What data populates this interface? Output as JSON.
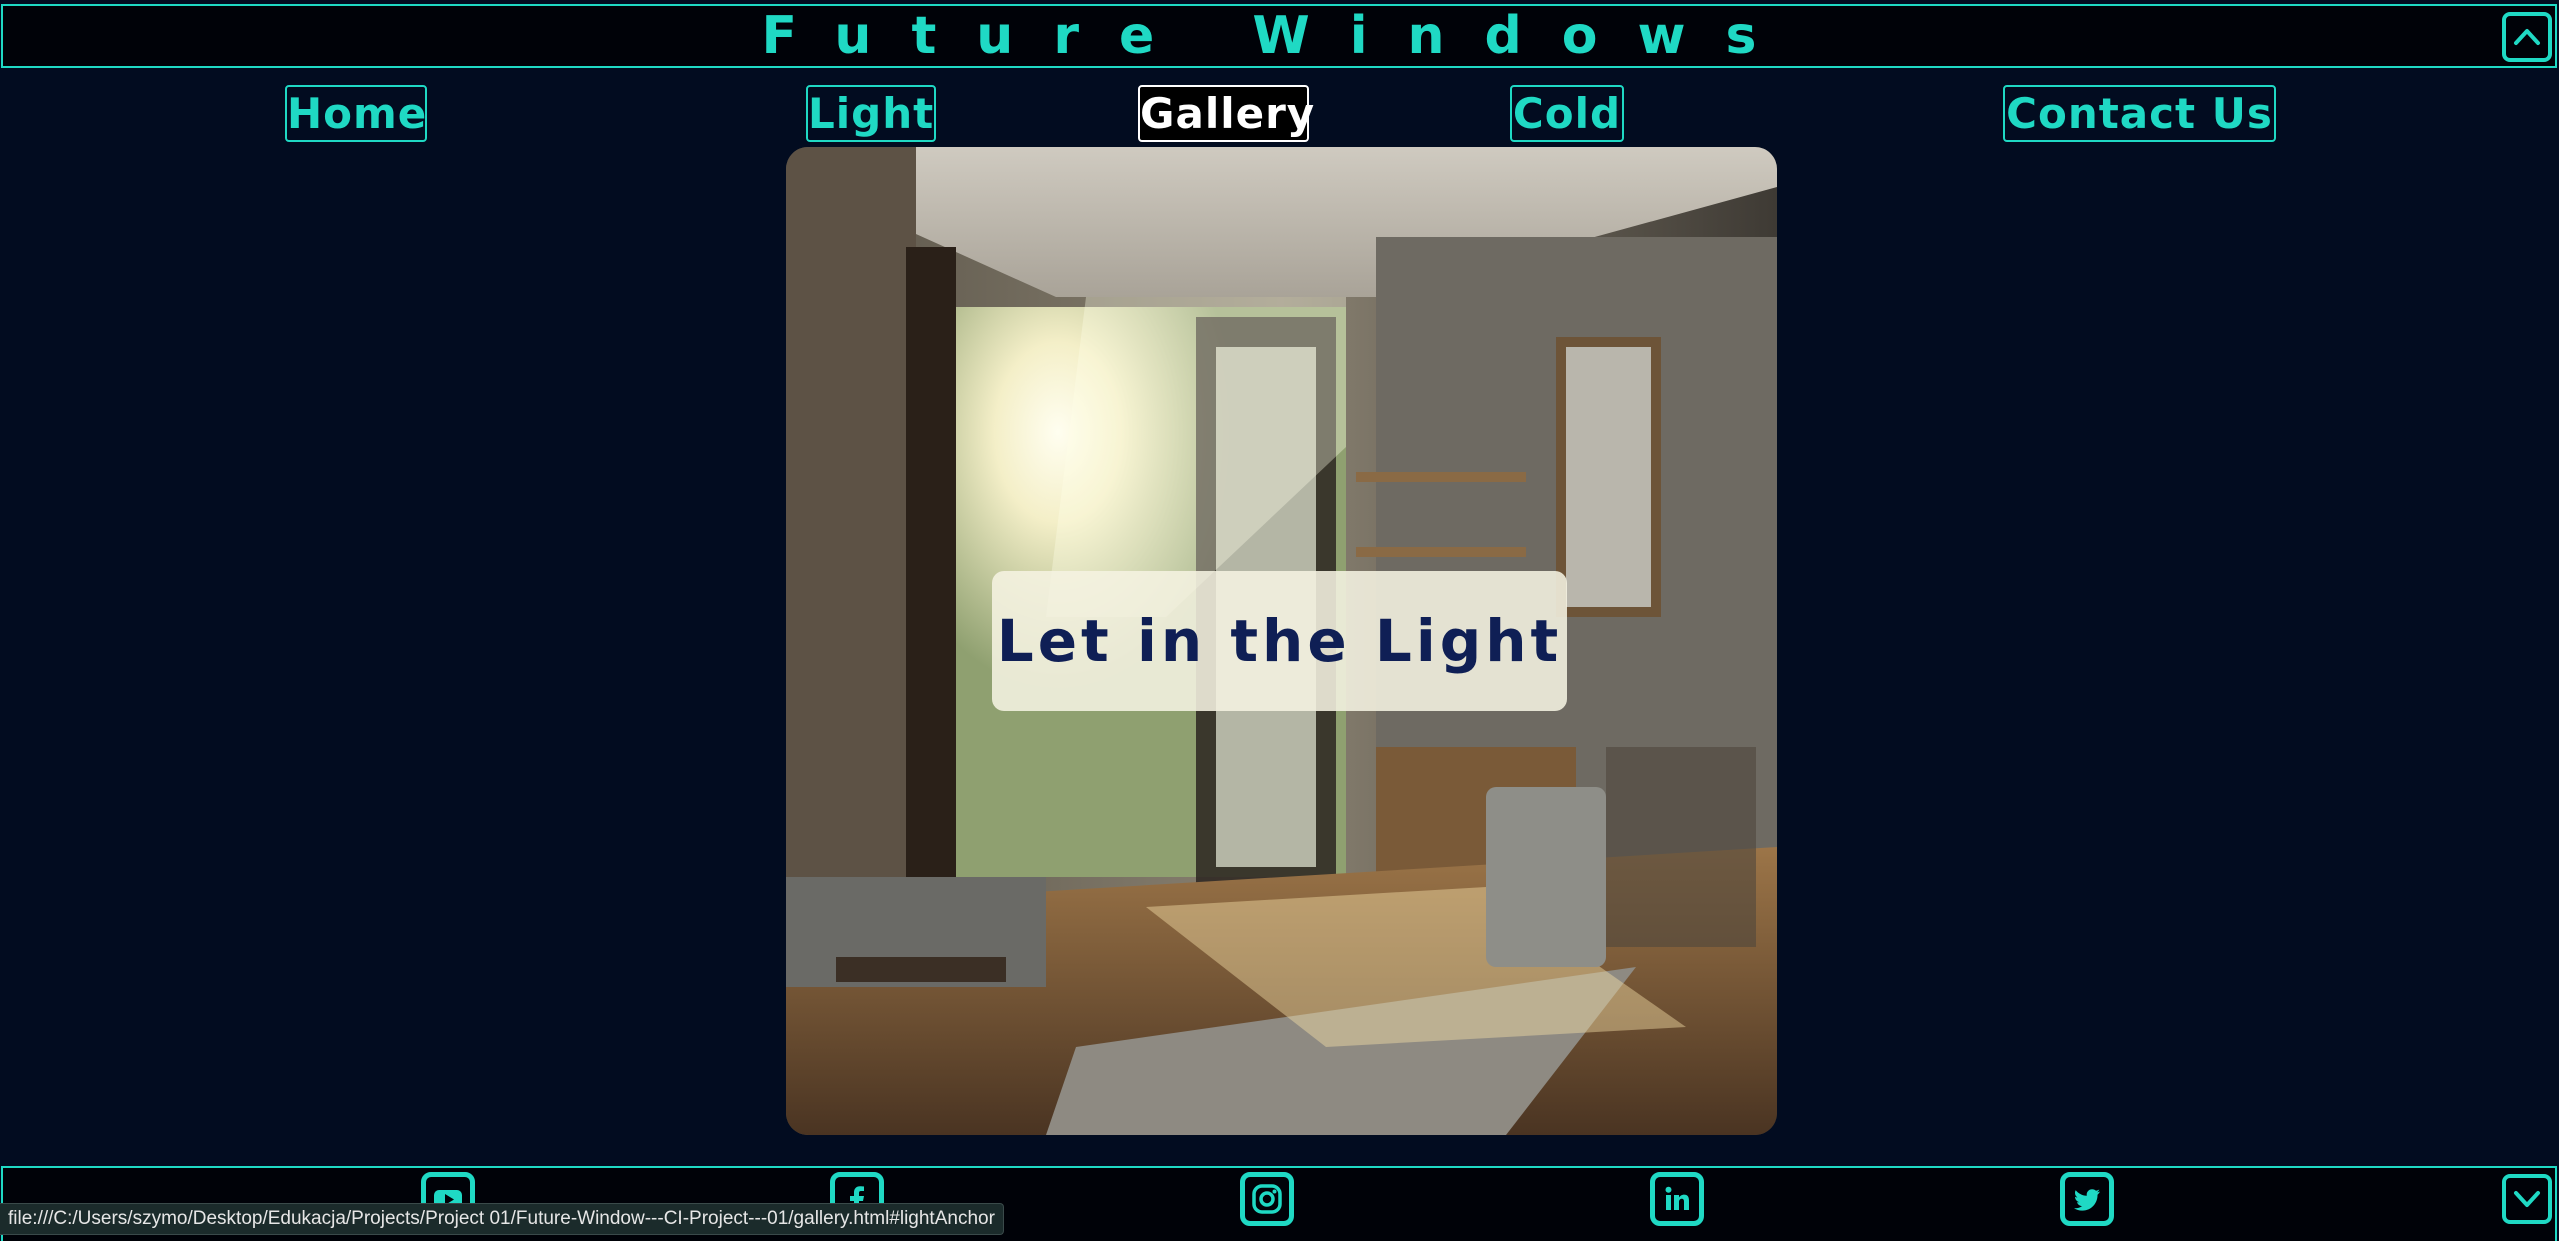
{
  "site": {
    "title": "Future Windows"
  },
  "nav": {
    "items": [
      {
        "label": "Home",
        "active": false
      },
      {
        "label": "Light",
        "active": false
      },
      {
        "label": "Gallery",
        "active": true
      },
      {
        "label": "Cold",
        "active": false
      },
      {
        "label": "Contact Us",
        "active": false
      }
    ]
  },
  "hero": {
    "caption": "Let in the Light"
  },
  "footer": {
    "social": [
      "youtube-icon",
      "facebook-icon",
      "instagram-icon",
      "linkedin-icon",
      "twitter-icon"
    ]
  },
  "statusbar": {
    "url": "file:///C:/Users/szymo/Desktop/Edukacja/Projects/Project 01/Future-Window---CI-Project---01/gallery.html#lightAnchor"
  },
  "colors": {
    "background": "#020c20",
    "accent": "#1fd9c4",
    "caption_text": "#0f1f55",
    "active_nav": "#ffffff"
  },
  "icons": {
    "scroll_up": "chevron-up-icon",
    "scroll_down": "chevron-down-icon"
  }
}
